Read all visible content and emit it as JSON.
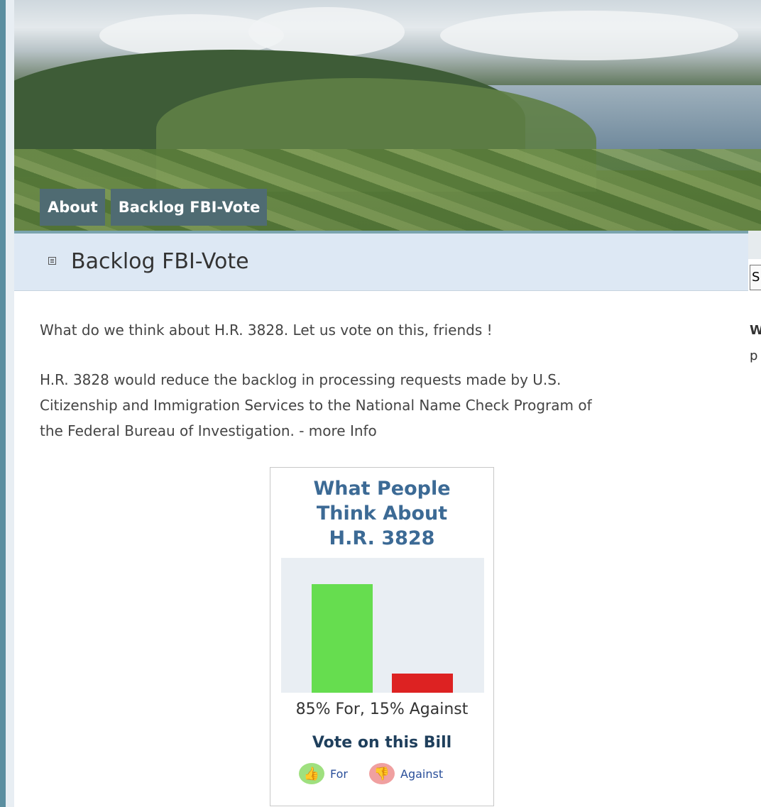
{
  "nav": {
    "tabs": [
      {
        "label": "About"
      },
      {
        "label": "Backlog FBI-Vote"
      }
    ]
  },
  "page": {
    "title": "Backlog FBI-Vote",
    "intro": "What do we think about H.R. 3828. Let us vote on this, friends !",
    "body_line1": "H.R. 3828 would reduce the backlog in processing requests made by U.S.",
    "body_line2": "Citizenship and Immigration Services to the National Name Check Program of",
    "body_line3": "the Federal Bureau of Investigation. - more Info"
  },
  "widget": {
    "title_line1": "What People",
    "title_line2": "Think About",
    "title_line3": "H.R. 3828",
    "summary": "85% For, 15% Against",
    "vote_heading": "Vote on this Bill",
    "for_label": "For",
    "against_label": "Against"
  },
  "chart_data": {
    "type": "bar",
    "categories": [
      "For",
      "Against"
    ],
    "values": [
      85,
      15
    ],
    "colors": [
      "#66dd4f",
      "#dd2222"
    ],
    "title": "What People Think About H.R. 3828",
    "ylim": [
      0,
      100
    ]
  },
  "sidebar_partial": {
    "box_char": "S",
    "w_char": "W",
    "p_char": "p"
  },
  "icons": {
    "title": "menu-icon",
    "for": "thumbs-up-icon",
    "against": "thumbs-down-icon"
  }
}
